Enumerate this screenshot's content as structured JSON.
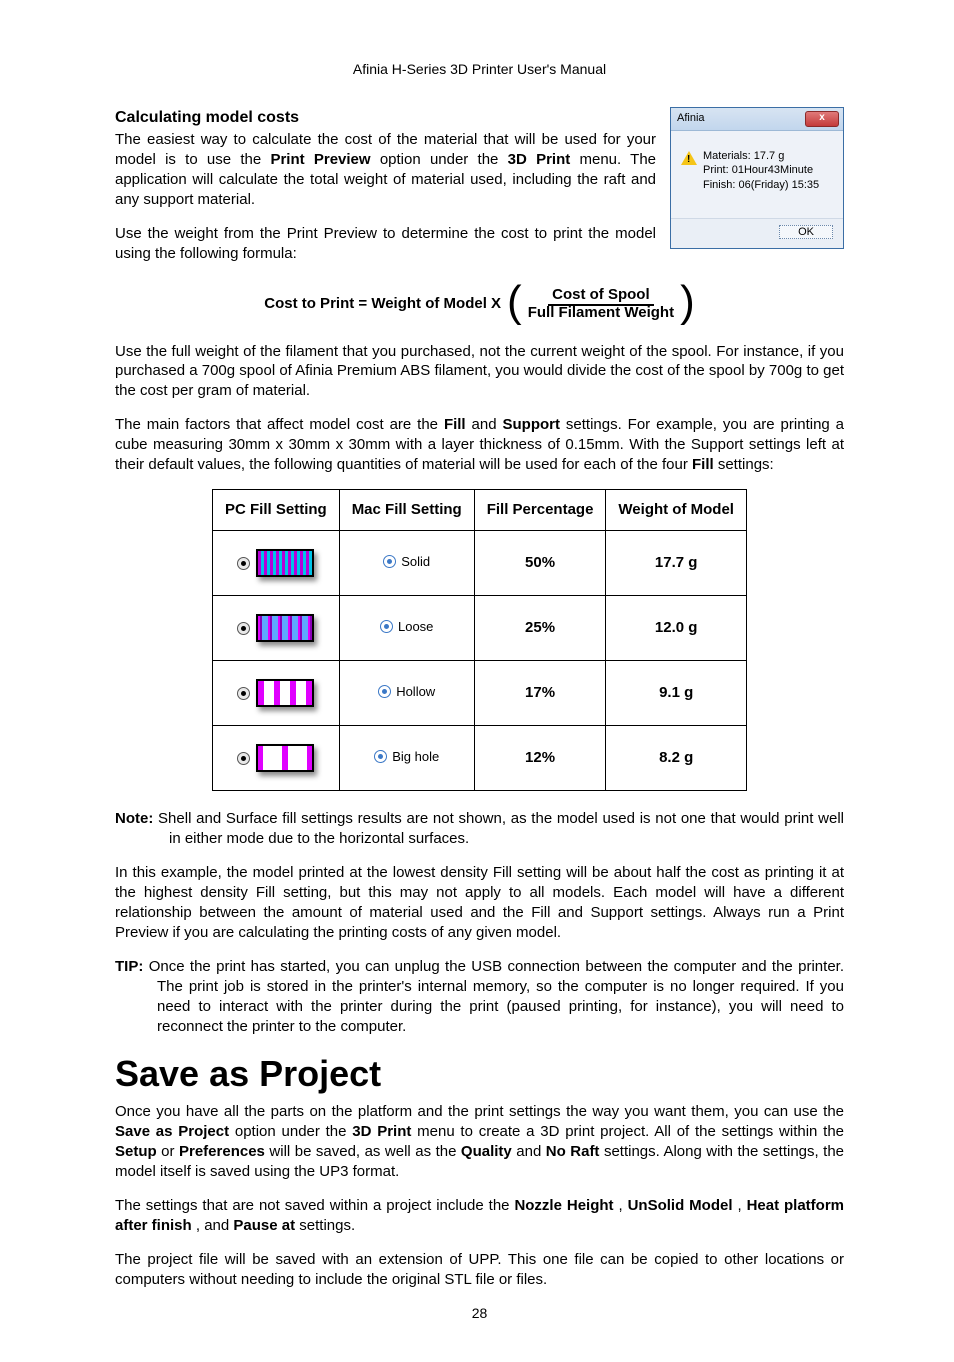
{
  "header": "Afinia H-Series 3D Printer User's Manual",
  "section1_title": "Calculating model costs",
  "dialog": {
    "title": "Afinia",
    "line1": "Materials: 17.7 g",
    "line2": "Print: 01Hour43Minute",
    "line3": "Finish: 06(Friday) 15:35",
    "ok": "OK"
  },
  "p1a": "The easiest way to calculate the cost of the material that will be used for your model is to use the ",
  "p1_bold1": "Print Preview",
  "p1b": " option under the ",
  "p1_bold2": "3D Print",
  "p1c": " menu.  The application will calculate the total weight of material used, including the raft and any support material.",
  "p2": "Use the weight from the Print Preview to determine the cost to print the model using the following formula:",
  "formula_left": "Cost to Print = Weight of Model X",
  "formula_top": "Cost of Spool",
  "formula_bot": "Full Filament Weight",
  "p3": "Use the full weight of the filament that you purchased, not the current weight of the spool.   For instance, if you purchased a 700g spool of Afinia Premium ABS filament, you would divide the cost of the spool by 700g to get the cost per gram of material.",
  "p4a": "The main factors that affect model cost are the ",
  "p4_b1": "Fill",
  "p4b": " and ",
  "p4_b2": "Support",
  "p4c": " settings.   For example, you are printing a cube measuring 30mm x 30mm x 30mm with a layer thickness of 0.15mm.   With the Support settings left at their default values, the following quantities of material will be used for each of the four ",
  "p4_b3": "Fill",
  "p4d": " settings:",
  "th1": "PC Fill Setting",
  "th2": "Mac Fill Setting",
  "th3": "Fill Percentage",
  "th4": "Weight of Model",
  "rows": [
    {
      "mac": "Solid",
      "pct": "50%",
      "wt": "17.7 g",
      "sw": "sw-50"
    },
    {
      "mac": "Loose",
      "pct": "25%",
      "wt": "12.0 g",
      "sw": "sw-25"
    },
    {
      "mac": "Hollow",
      "pct": "17%",
      "wt": "9.1 g",
      "sw": "sw-17"
    },
    {
      "mac": "Big hole",
      "pct": "12%",
      "wt": "8.2 g",
      "sw": "sw-12"
    }
  ],
  "note_label": "Note:",
  "note_text": " Shell and Surface fill settings results are not shown, as the model used is not one that would print well in either mode due to the horizontal surfaces.",
  "p5": "In this example, the model printed at the lowest density Fill setting will be about half the cost as printing it at the highest density Fill setting, but this may not apply to all models.   Each model will have a different relationship between the amount of material used and the Fill and Support settings.  Always run a Print Preview if you are calculating the printing costs of any given model.",
  "tip_label": "TIP:",
  "tip_text": " Once the print has started, you can unplug the USB connection between the computer and the printer.   The print job is stored in the printer's internal memory, so the computer is no longer required.   If you need to interact with the printer during the print (paused printing, for instance), you will need to reconnect the printer to the computer.",
  "h1": "Save as Project",
  "sp1a": "Once you have all the parts on the platform and the print settings the way you want them, you can use the ",
  "sp_b1": "Save as Project",
  "sp1b": " option under the ",
  "sp_b2": "3D Print",
  "sp1c": " menu to create a 3D print project.   All of the settings within the ",
  "sp_b3": "Setup",
  "sp1d": " or ",
  "sp_b4": "Preferences",
  "sp1e": "  will  be  saved,  as  well  as  the  ",
  "sp_b5": "Quality",
  "sp1f": "  and  ",
  "sp_b6": "No  Raft",
  "sp1g": " settings.   Along with the settings, the model itself is saved using the UP3 format.",
  "sp2a": "The settings that are not saved within a project include the ",
  "sp2_b1": "Nozzle Height",
  "sp2b": ", ",
  "sp2_b2": "UnSolid Model",
  "sp2c": ", ",
  "sp2_b3": "Heat platform after finish",
  "sp2d": ", and ",
  "sp2_b4": "Pause at",
  "sp2e": " settings.",
  "sp3": "The project file will be saved with an extension of UPP.   This one file can be copied to other locations or computers without needing to include the original STL file or files.",
  "page_number": "28"
}
